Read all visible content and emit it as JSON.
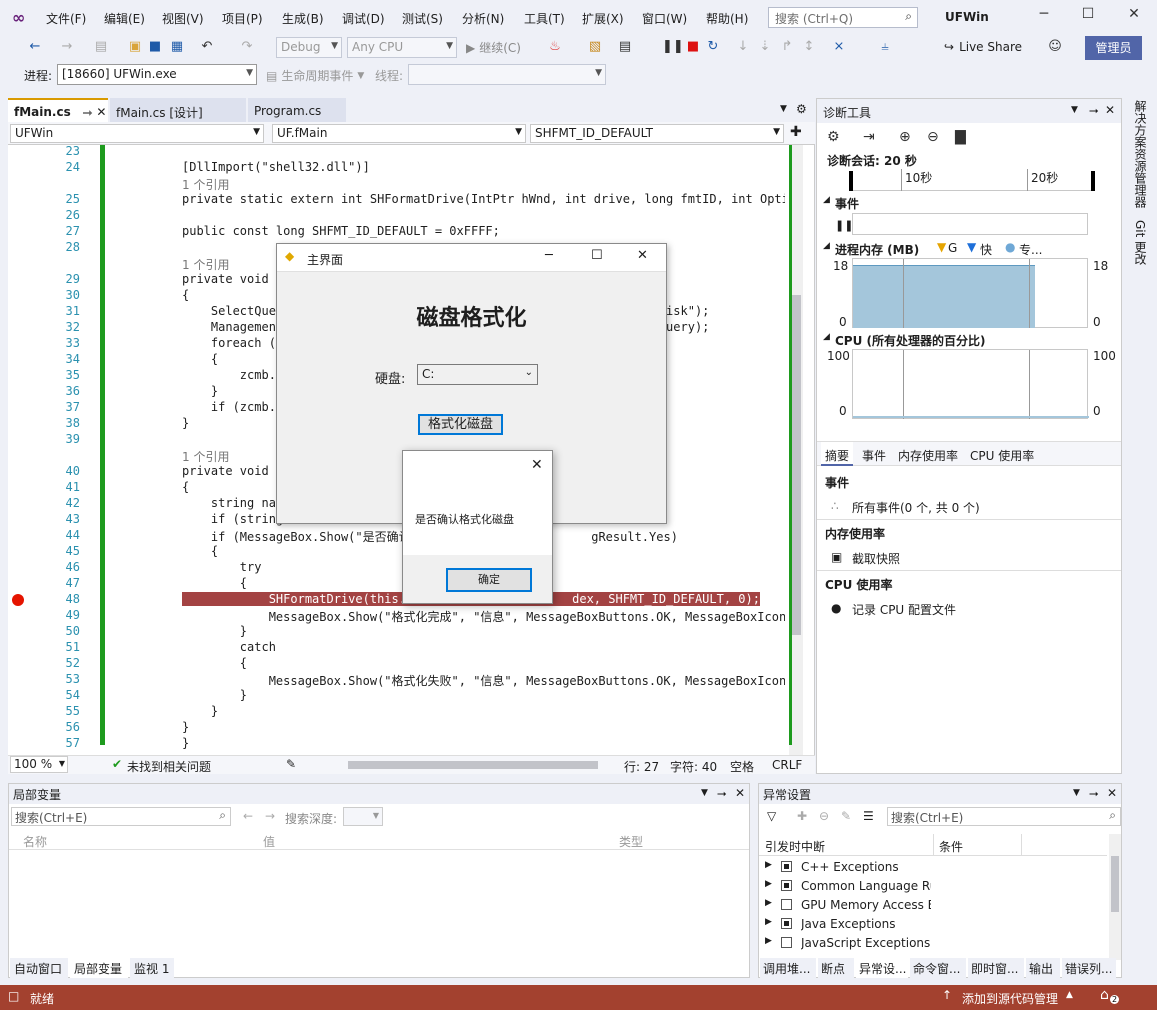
{
  "app": {
    "title": "UFWin",
    "admin_label": "管理员",
    "search_placeholder": "搜索 (Ctrl+Q)"
  },
  "menu": [
    "文件(F)",
    "编辑(E)",
    "视图(V)",
    "项目(P)",
    "生成(B)",
    "调试(D)",
    "测试(S)",
    "分析(N)",
    "工具(T)",
    "扩展(X)",
    "窗口(W)",
    "帮助(H)"
  ],
  "toolbar": {
    "config": "Debug",
    "platform": "Any CPU",
    "continue": "继续(C)",
    "live_share": "Live Share",
    "process_label": "进程:",
    "process": "[18660] UFWin.exe",
    "lifecycle": "生命周期事件",
    "thread_label": "线程:"
  },
  "tabs": [
    "fMain.cs",
    "fMain.cs [设计]",
    "Program.cs"
  ],
  "nav": {
    "project": "UFWin",
    "class": "UF.fMain",
    "member": "SHFMT_ID_DEFAULT"
  },
  "code": [
    {
      "n": "23",
      "t": ""
    },
    {
      "n": "24",
      "t": "[DllImport(\"shell32.dll\")]"
    },
    {
      "n": "",
      "t": "1 个引用",
      "ref": true
    },
    {
      "n": "25",
      "t": "private static extern int SHFormatDrive(IntPtr hWnd, int drive, long fmtID, int Options);"
    },
    {
      "n": "26",
      "t": ""
    },
    {
      "n": "27",
      "t": "public const long SHFMT_ID_DEFAULT = 0xFFFF;"
    },
    {
      "n": "28",
      "t": ""
    },
    {
      "n": "",
      "t": "1 个引用",
      "ref": true
    },
    {
      "n": "29",
      "t": "private void fM"
    },
    {
      "n": "30",
      "t": "{"
    },
    {
      "n": "31",
      "t": "    SelectQuery                                               icaldisk\");"
    },
    {
      "n": "32",
      "t": "    ManagementO                                              electQuery);"
    },
    {
      "n": "33",
      "t": "    foreach (Ma"
    },
    {
      "n": "34",
      "t": "    {"
    },
    {
      "n": "35",
      "t": "        zcmb.It"
    },
    {
      "n": "36",
      "t": "    }"
    },
    {
      "n": "37",
      "t": "    if (zcmb.It"
    },
    {
      "n": "38",
      "t": "}"
    },
    {
      "n": "39",
      "t": ""
    },
    {
      "n": "",
      "t": "1 个引用",
      "ref": true
    },
    {
      "n": "40",
      "t": "private void zb"
    },
    {
      "n": "41",
      "t": "{"
    },
    {
      "n": "42",
      "t": "    string name"
    },
    {
      "n": "43",
      "t": "    if (string."
    },
    {
      "n": "44",
      "t": "    if (MessageBox.Show(\"是否确认                         gResult.Yes)"
    },
    {
      "n": "45",
      "t": "    {"
    },
    {
      "n": "46",
      "t": "        try"
    },
    {
      "n": "47",
      "t": "        {"
    },
    {
      "n": "48",
      "t": "            SHFormatDrive(this.Ha                     dex, SHFMT_ID_DEFAULT, 0);",
      "bp": true
    },
    {
      "n": "49",
      "t": "            MessageBox.Show(\"格式化完成\", \"信息\", MessageBoxButtons.OK, MessageBoxIcon.I"
    },
    {
      "n": "50",
      "t": "        }"
    },
    {
      "n": "51",
      "t": "        catch"
    },
    {
      "n": "52",
      "t": "        {"
    },
    {
      "n": "53",
      "t": "            MessageBox.Show(\"格式化失败\", \"信息\", MessageBoxButtons.OK, MessageBoxIcon.I"
    },
    {
      "n": "54",
      "t": "        }"
    },
    {
      "n": "55",
      "t": "    }"
    },
    {
      "n": "56",
      "t": "}"
    },
    {
      "n": "57",
      "t": "}"
    }
  ],
  "editor_status": {
    "zoom": "100 %",
    "issues": "未找到相关问题",
    "line": "行: 27",
    "col": "字符: 40",
    "spaces": "空格",
    "eol": "CRLF"
  },
  "main_form": {
    "title": "主界面",
    "heading": "磁盘格式化",
    "disk_label": "硬盘:",
    "disk_value": "C:",
    "format_button": "格式化磁盘"
  },
  "message_box": {
    "text": "是否确认格式化磁盘",
    "ok": "确定"
  },
  "diag": {
    "title": "诊断工具",
    "session": "诊断会话: 20 秒",
    "tick1": "10秒",
    "tick2": "20秒",
    "events": "事件",
    "memory": "进程内存 (MB)",
    "mem_legend": [
      "G",
      "快",
      "专..."
    ],
    "mem_max": "18",
    "mem_min": "0",
    "cpu": "CPU (所有处理器的百分比)",
    "cpu_max": "100",
    "cpu_min": "0",
    "tabs": [
      "摘要",
      "事件",
      "内存使用率",
      "CPU 使用率"
    ],
    "events_section": "事件",
    "all_events": "所有事件(0 个, 共 0 个)",
    "mem_section": "内存使用率",
    "snapshot": "截取快照",
    "cpu_section": "CPU 使用率",
    "record_cpu": "记录 CPU 配置文件"
  },
  "sidebar": [
    "解决方案资源管理器",
    "Git 更改"
  ],
  "locals": {
    "title": "局部变量",
    "search": "搜索(Ctrl+E)",
    "depth_label": "搜索深度:",
    "cols": [
      "名称",
      "值",
      "类型"
    ]
  },
  "locals_tabs": [
    "自动窗口",
    "局部变量",
    "监视 1"
  ],
  "exceptions": {
    "title": "异常设置",
    "search": "搜索(Ctrl+E)",
    "cols": [
      "引发时中断",
      "条件"
    ],
    "rows": [
      {
        "name": "C++ Exceptions",
        "checked": true
      },
      {
        "name": "Common Language Ru",
        "checked": true
      },
      {
        "name": "GPU Memory Access E",
        "checked": false
      },
      {
        "name": "Java Exceptions",
        "checked": true
      },
      {
        "name": "JavaScript Exceptions",
        "checked": false
      }
    ]
  },
  "exc_tabs": [
    "调用堆...",
    "断点",
    "异常设...",
    "命令窗...",
    "即时窗...",
    "输出",
    "错误列..."
  ],
  "status": {
    "ready": "就绪",
    "source_control": "添加到源代码管理",
    "notif": "2"
  },
  "colors": {
    "accent": "#5165a8",
    "status": "#a3412f",
    "changebar": "#1e9b1e",
    "breakpoint": "#e51400"
  }
}
